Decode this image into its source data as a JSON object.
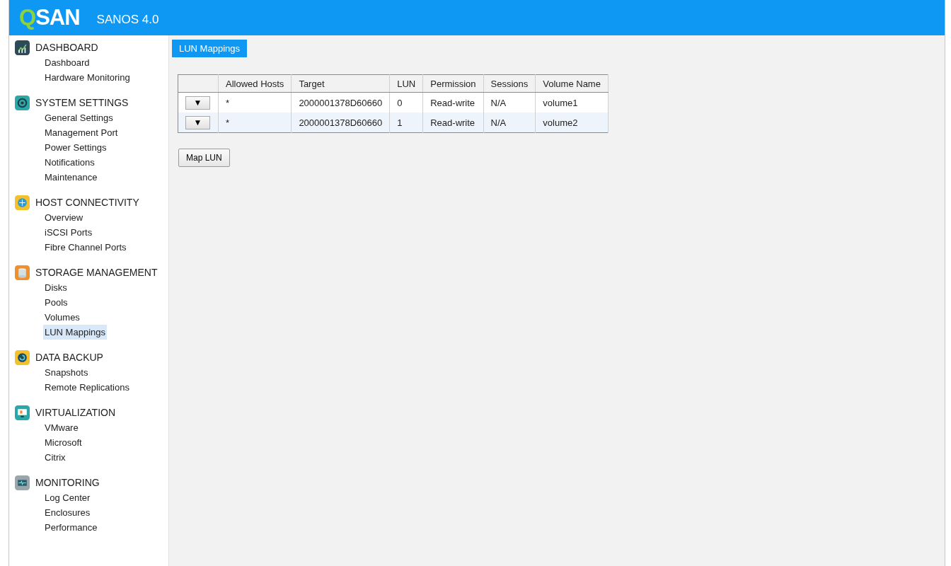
{
  "header": {
    "logo": {
      "accent": "Q",
      "rest": "SAN"
    },
    "product": "SANOS 4.0"
  },
  "sidebar": {
    "sections": [
      {
        "title": "DASHBOARD",
        "items": [
          {
            "label": "Dashboard",
            "selected": false
          },
          {
            "label": "Hardware Monitoring",
            "selected": false
          }
        ]
      },
      {
        "title": "SYSTEM SETTINGS",
        "items": [
          {
            "label": "General Settings",
            "selected": false
          },
          {
            "label": "Management Port",
            "selected": false
          },
          {
            "label": "Power Settings",
            "selected": false
          },
          {
            "label": "Notifications",
            "selected": false
          },
          {
            "label": "Maintenance",
            "selected": false
          }
        ]
      },
      {
        "title": "HOST CONNECTIVITY",
        "items": [
          {
            "label": "Overview",
            "selected": false
          },
          {
            "label": "iSCSI Ports",
            "selected": false
          },
          {
            "label": "Fibre Channel Ports",
            "selected": false
          }
        ]
      },
      {
        "title": "STORAGE MANAGEMENT",
        "items": [
          {
            "label": "Disks",
            "selected": false
          },
          {
            "label": "Pools",
            "selected": false
          },
          {
            "label": "Volumes",
            "selected": false
          },
          {
            "label": "LUN Mappings",
            "selected": true
          }
        ]
      },
      {
        "title": "DATA BACKUP",
        "items": [
          {
            "label": "Snapshots",
            "selected": false
          },
          {
            "label": "Remote Replications",
            "selected": false
          }
        ]
      },
      {
        "title": "VIRTUALIZATION",
        "items": [
          {
            "label": "VMware",
            "selected": false
          },
          {
            "label": "Microsoft",
            "selected": false
          },
          {
            "label": "Citrix",
            "selected": false
          }
        ]
      },
      {
        "title": "MONITORING",
        "items": [
          {
            "label": "Log Center",
            "selected": false
          },
          {
            "label": "Enclosures",
            "selected": false
          },
          {
            "label": "Performance",
            "selected": false
          }
        ]
      }
    ]
  },
  "page": {
    "title": "LUN Mappings",
    "table": {
      "columns": [
        "Allowed Hosts",
        "Target",
        "LUN",
        "Permission",
        "Sessions",
        "Volume Name"
      ],
      "rows": [
        {
          "menu": "▼",
          "cells": [
            "*",
            "2000001378D60660",
            "0",
            "Read-write",
            "N/A",
            "volume1"
          ]
        },
        {
          "menu": "▼",
          "cells": [
            "*",
            "2000001378D60660",
            "1",
            "Read-write",
            "N/A",
            "volume2"
          ]
        }
      ]
    },
    "buttons": [
      "Map LUN"
    ]
  }
}
